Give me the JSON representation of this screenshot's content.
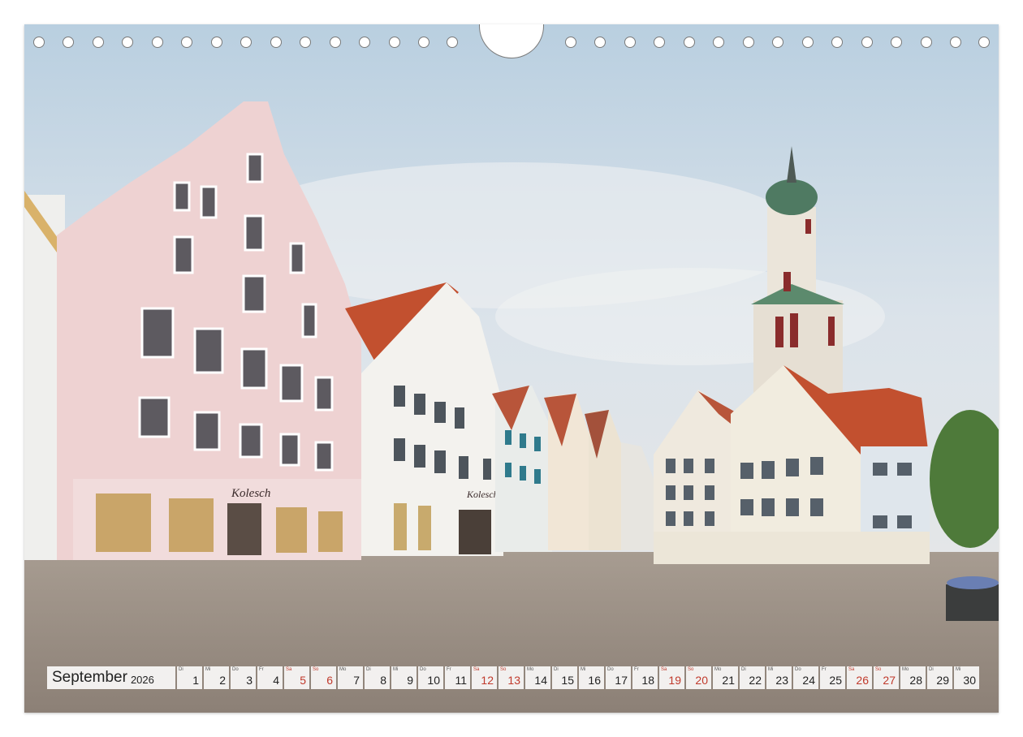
{
  "calendar": {
    "month": "September",
    "year": "2026",
    "weekend_color": "#c0392b",
    "days": [
      {
        "wd": "Di",
        "num": "1",
        "weekend": false
      },
      {
        "wd": "Mi",
        "num": "2",
        "weekend": false
      },
      {
        "wd": "Do",
        "num": "3",
        "weekend": false
      },
      {
        "wd": "Fr",
        "num": "4",
        "weekend": false
      },
      {
        "wd": "Sa",
        "num": "5",
        "weekend": true
      },
      {
        "wd": "So",
        "num": "6",
        "weekend": true
      },
      {
        "wd": "Mo",
        "num": "7",
        "weekend": false
      },
      {
        "wd": "Di",
        "num": "8",
        "weekend": false
      },
      {
        "wd": "Mi",
        "num": "9",
        "weekend": false
      },
      {
        "wd": "Do",
        "num": "10",
        "weekend": false
      },
      {
        "wd": "Fr",
        "num": "11",
        "weekend": false
      },
      {
        "wd": "Sa",
        "num": "12",
        "weekend": true
      },
      {
        "wd": "So",
        "num": "13",
        "weekend": true
      },
      {
        "wd": "Mo",
        "num": "14",
        "weekend": false
      },
      {
        "wd": "Di",
        "num": "15",
        "weekend": false
      },
      {
        "wd": "Mi",
        "num": "16",
        "weekend": false
      },
      {
        "wd": "Do",
        "num": "17",
        "weekend": false
      },
      {
        "wd": "Fr",
        "num": "18",
        "weekend": false
      },
      {
        "wd": "Sa",
        "num": "19",
        "weekend": true
      },
      {
        "wd": "So",
        "num": "20",
        "weekend": true
      },
      {
        "wd": "Mo",
        "num": "21",
        "weekend": false
      },
      {
        "wd": "Di",
        "num": "22",
        "weekend": false
      },
      {
        "wd": "Mi",
        "num": "23",
        "weekend": false
      },
      {
        "wd": "Do",
        "num": "24",
        "weekend": false
      },
      {
        "wd": "Fr",
        "num": "25",
        "weekend": false
      },
      {
        "wd": "Sa",
        "num": "26",
        "weekend": true
      },
      {
        "wd": "So",
        "num": "27",
        "weekend": true
      },
      {
        "wd": "Mo",
        "num": "28",
        "weekend": false
      },
      {
        "wd": "Di",
        "num": "29",
        "weekend": false
      },
      {
        "wd": "Mi",
        "num": "30",
        "weekend": false
      }
    ]
  },
  "photo": {
    "shop_sign_left": "Kolesch",
    "shop_sign_middle": "Kolesch"
  }
}
